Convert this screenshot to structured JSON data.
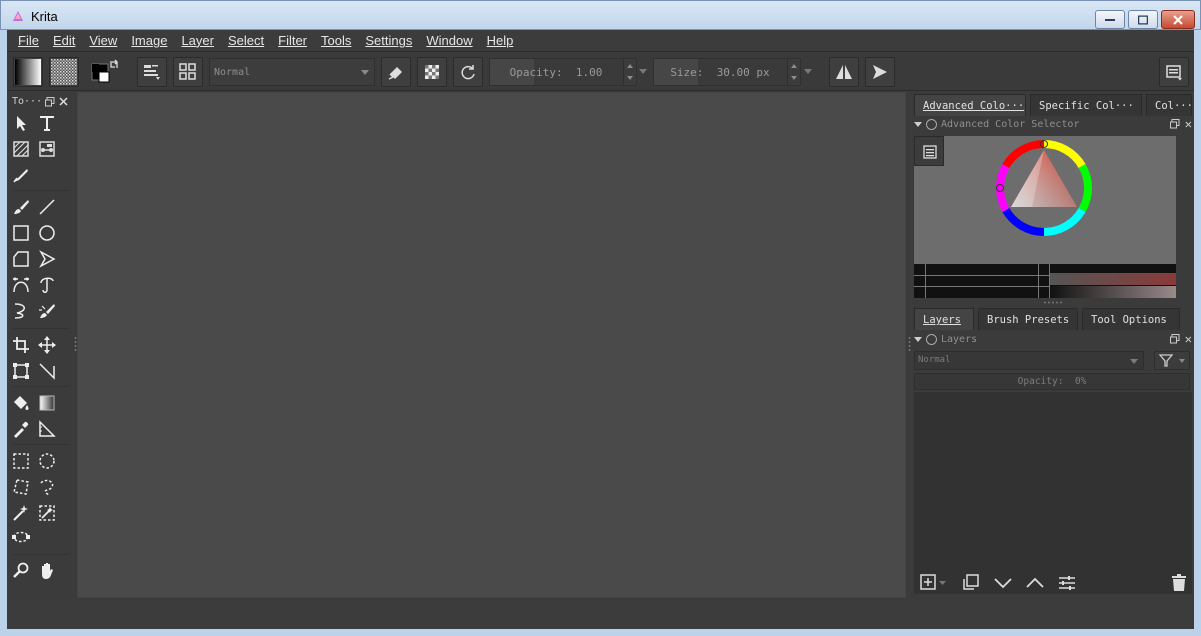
{
  "window": {
    "title": "Krita"
  },
  "menu": [
    "File",
    "Edit",
    "View",
    "Image",
    "Layer",
    "Select",
    "Filter",
    "Tools",
    "Settings",
    "Window",
    "Help"
  ],
  "toolbar": {
    "blend_mode": "Normal",
    "opacity_label": "Opacity:",
    "opacity_value": "1.00",
    "size_label": "Size:",
    "size_value": "30.00 px",
    "opacity_fraction": 1.0,
    "size_fraction": 0.3
  },
  "toolbox": {
    "title": "To···"
  },
  "dock": {
    "top_tabs": [
      "Advanced Colo···",
      "Specific Col···",
      "Col···"
    ],
    "color_panel_title": "Advanced Color Selector",
    "bottom_tabs": [
      "Layers",
      "Brush Presets",
      "Tool Options"
    ],
    "layers_panel_title": "Layers",
    "layers_blend_mode": "Normal",
    "layers_opacity_label": "Opacity:",
    "layers_opacity_value": "0%"
  },
  "colors": {
    "window_frame": "#bcd2ea",
    "app_bg": "#3b3b3b",
    "canvas": "#4a4a4a",
    "accent_red": "#c0392b"
  }
}
